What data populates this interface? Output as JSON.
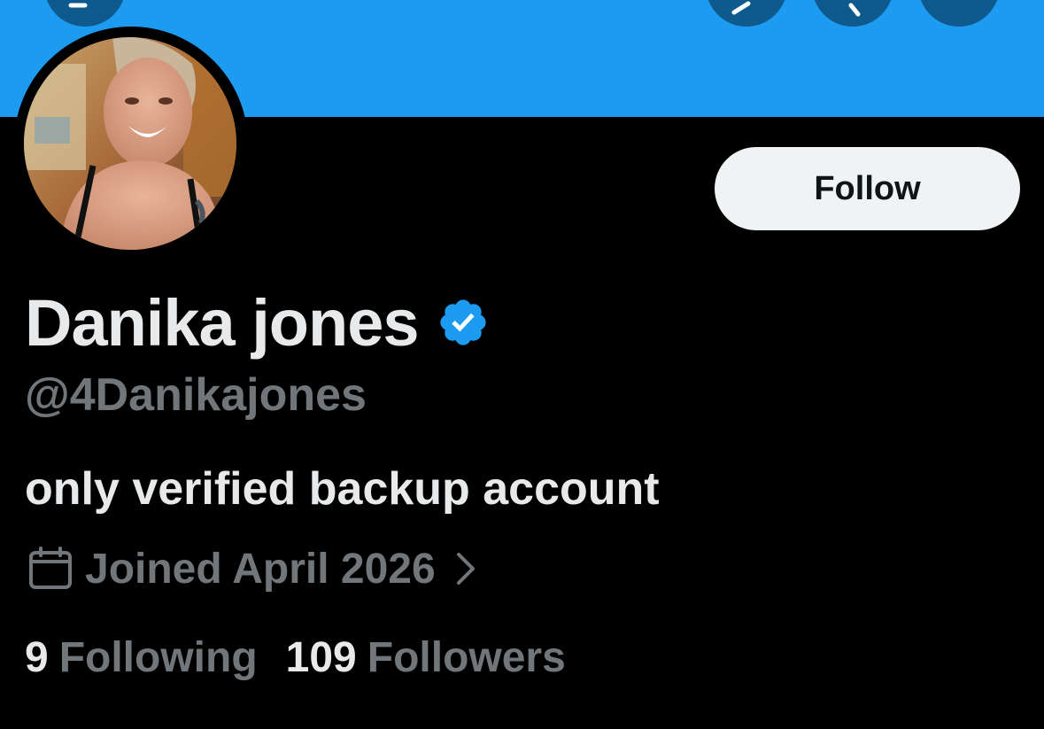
{
  "profile": {
    "display_name": "Danika jones",
    "handle": "@4Danikajones",
    "bio": "only verified backup account",
    "joined": "Joined April 2026",
    "following_count": "9",
    "following_label": "Following",
    "followers_count": "109",
    "followers_label": "Followers",
    "verified": true
  },
  "actions": {
    "follow_label": "Follow"
  },
  "icons": {
    "back": "back-arrow-icon",
    "top_1": "grok-icon",
    "top_2": "search-icon",
    "top_3": "more-icon",
    "verified": "verified-badge-icon",
    "calendar": "calendar-icon",
    "chevron": "chevron-right-icon"
  },
  "colors": {
    "banner": "#1d9bf0",
    "background": "#000000",
    "primary_text": "#e7e9ea",
    "secondary_text": "#71767b",
    "follow_button_bg": "#eff3f4",
    "verified_badge": "#1d9bf0"
  }
}
